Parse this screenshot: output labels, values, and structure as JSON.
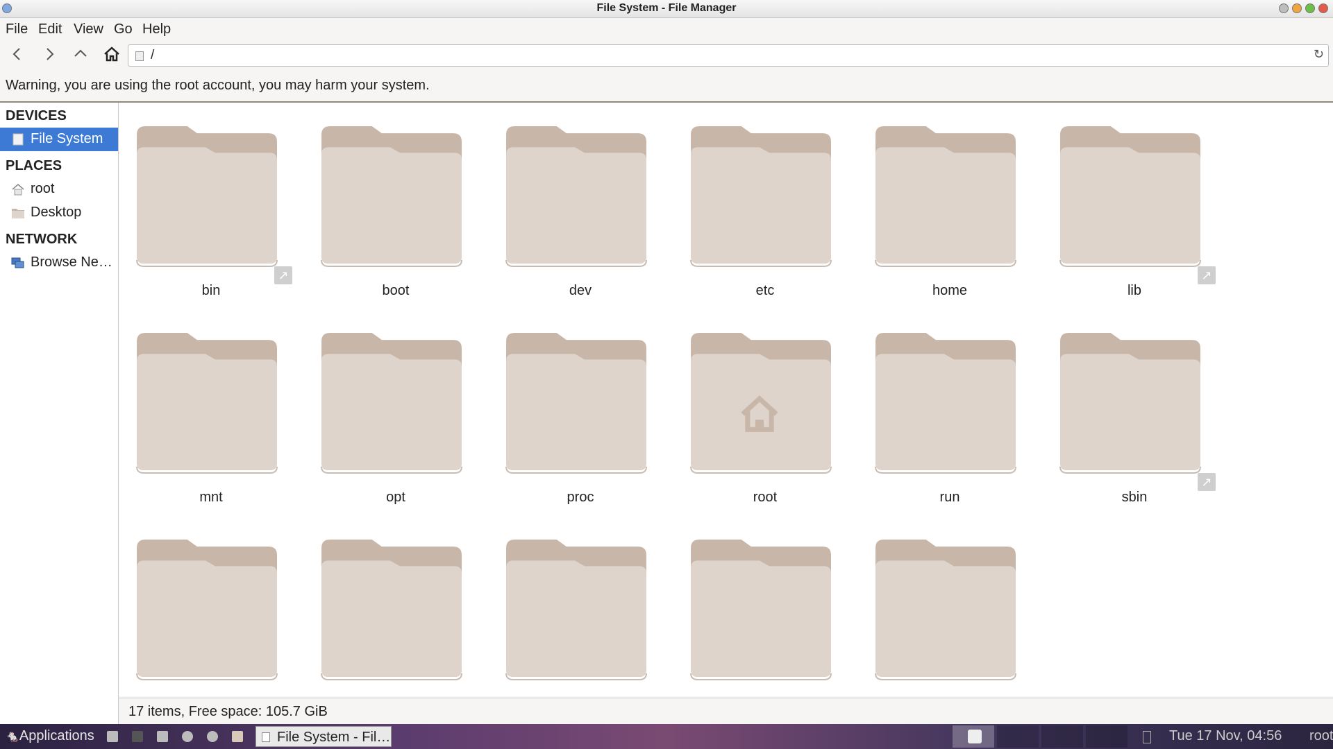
{
  "window": {
    "title": "File System - File Manager"
  },
  "menu": [
    "File",
    "Edit",
    "View",
    "Go",
    "Help"
  ],
  "location": {
    "path": "/"
  },
  "warning": "Warning, you are using the root account, you may harm your system.",
  "sidebar": {
    "devices_heading": "DEVICES",
    "devices": [
      {
        "label": "File System",
        "icon": "drive-icon",
        "selected": true
      }
    ],
    "places_heading": "PLACES",
    "places": [
      {
        "label": "root",
        "icon": "home-icon"
      },
      {
        "label": "Desktop",
        "icon": "desktop-icon"
      }
    ],
    "network_heading": "NETWORK",
    "network": [
      {
        "label": "Browse Ne…",
        "icon": "network-icon"
      }
    ]
  },
  "folders": [
    {
      "name": "bin",
      "symlink": true
    },
    {
      "name": "boot",
      "symlink": false
    },
    {
      "name": "dev",
      "symlink": false
    },
    {
      "name": "etc",
      "symlink": false
    },
    {
      "name": "home",
      "symlink": false
    },
    {
      "name": "lib",
      "symlink": true
    },
    {
      "name": "mnt",
      "symlink": false
    },
    {
      "name": "opt",
      "symlink": false
    },
    {
      "name": "proc",
      "symlink": false
    },
    {
      "name": "root",
      "symlink": false,
      "home_emblem": true
    },
    {
      "name": "run",
      "symlink": false
    },
    {
      "name": "sbin",
      "symlink": true
    },
    {
      "name": "",
      "symlink": false
    },
    {
      "name": "",
      "symlink": false
    },
    {
      "name": "",
      "symlink": false
    },
    {
      "name": "",
      "symlink": false
    },
    {
      "name": "",
      "symlink": false
    }
  ],
  "status": {
    "text": "17 items, Free space: 105.7 GiB"
  },
  "taskbar": {
    "applications": "Applications",
    "task_label": "File System - Fil…",
    "clock": "Tue 17 Nov, 04:56",
    "user": "root"
  },
  "colors": {
    "selection": "#3d7ad6",
    "folder_back": "#c8b7a9",
    "folder_front": "#ded4cc"
  }
}
